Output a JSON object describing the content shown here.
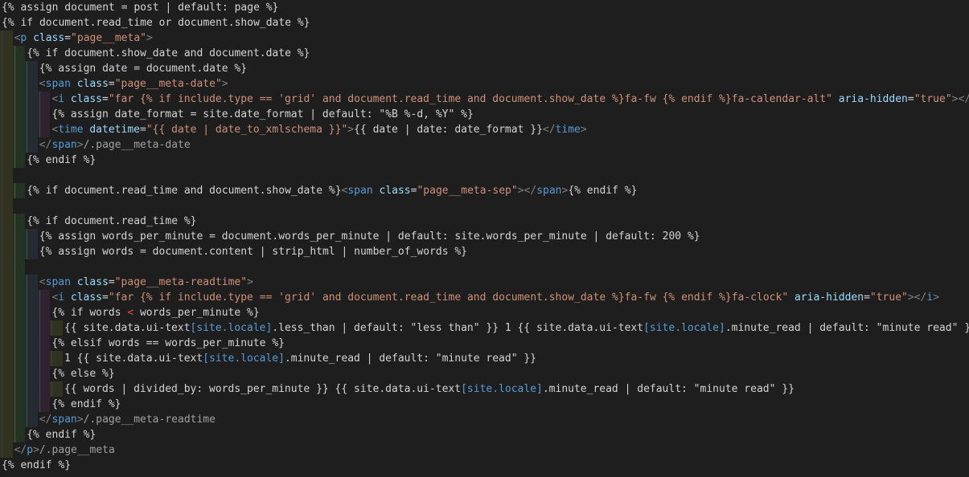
{
  "colors": {
    "background": "#1e1e1e",
    "liquid": "#d4d4d4",
    "tag": "#808080",
    "tag_name": "#569cd6",
    "attr": "#9cdcfe",
    "string": "#ce9178",
    "comment": "#a0a0a0",
    "operator": "#d4d4d4",
    "red": "#f44747"
  },
  "lines": [
    {
      "indent": 0,
      "tokens": [
        [
          "l",
          "{% assign document = post | default: page %}"
        ]
      ]
    },
    {
      "indent": 0,
      "tokens": [
        [
          "l",
          "{% if document.read_time or document.show_date %}"
        ]
      ]
    },
    {
      "indent": 1,
      "tokens": [
        [
          "t",
          "<"
        ],
        [
          "n",
          "p"
        ],
        [
          "t",
          " "
        ],
        [
          "a",
          "class"
        ],
        [
          "l",
          "="
        ],
        [
          "s",
          "\"page__meta\""
        ],
        [
          "t",
          ">"
        ]
      ]
    },
    {
      "indent": 2,
      "tokens": [
        [
          "l",
          "{% if document.show_date and document.date %}"
        ]
      ]
    },
    {
      "indent": 3,
      "tokens": [
        [
          "l",
          "{% assign date = document.date %}"
        ]
      ]
    },
    {
      "indent": 3,
      "tokens": [
        [
          "t",
          "<"
        ],
        [
          "n",
          "span"
        ],
        [
          "t",
          " "
        ],
        [
          "a",
          "class"
        ],
        [
          "l",
          "="
        ],
        [
          "s",
          "\"page__meta-date\""
        ],
        [
          "t",
          ">"
        ]
      ]
    },
    {
      "indent": 4,
      "tokens": [
        [
          "t",
          "<"
        ],
        [
          "n",
          "i"
        ],
        [
          "t",
          " "
        ],
        [
          "a",
          "class"
        ],
        [
          "l",
          "="
        ],
        [
          "s",
          "\"far "
        ],
        [
          "s",
          "{% if include.type == 'grid' and document.read_time and document.show_date %}"
        ],
        [
          "s",
          "fa-fw "
        ],
        [
          "s",
          "{% endif %}"
        ],
        [
          "s",
          "fa-calendar-alt\""
        ],
        [
          "t",
          " "
        ],
        [
          "a",
          "aria-hidden"
        ],
        [
          "l",
          "="
        ],
        [
          "s",
          "\"true\""
        ],
        [
          "t",
          "></"
        ],
        [
          "n",
          "i"
        ],
        [
          "t",
          ">"
        ]
      ]
    },
    {
      "indent": 4,
      "tokens": [
        [
          "l",
          "{% assign date_format = site.date_format | default: \"%B %-d, %Y\" %}"
        ]
      ]
    },
    {
      "indent": 4,
      "tokens": [
        [
          "t",
          "<"
        ],
        [
          "n",
          "time"
        ],
        [
          "t",
          " "
        ],
        [
          "a",
          "datetime"
        ],
        [
          "l",
          "="
        ],
        [
          "s",
          "\"{{ date | date_to_xmlschema }}\""
        ],
        [
          "t",
          ">"
        ],
        [
          "l",
          "{{ date | date: date_format }}"
        ],
        [
          "t",
          "</"
        ],
        [
          "n",
          "time"
        ],
        [
          "t",
          ">"
        ]
      ]
    },
    {
      "indent": 3,
      "tokens": [
        [
          "t",
          "</"
        ],
        [
          "n",
          "span"
        ],
        [
          "t",
          ">"
        ],
        [
          "c",
          "/.page__meta-date"
        ]
      ]
    },
    {
      "indent": 2,
      "tokens": [
        [
          "l",
          "{% endif %}"
        ]
      ]
    },
    {
      "indent": 1,
      "tokens": []
    },
    {
      "indent": 2,
      "tokens": [
        [
          "l",
          "{% if document.read_time and document.show_date %}"
        ],
        [
          "t",
          "<"
        ],
        [
          "n",
          "span"
        ],
        [
          "t",
          " "
        ],
        [
          "a",
          "class"
        ],
        [
          "l",
          "="
        ],
        [
          "s",
          "\"page__meta-sep\""
        ],
        [
          "t",
          "></"
        ],
        [
          "n",
          "span"
        ],
        [
          "t",
          ">"
        ],
        [
          "l",
          "{% endif %}"
        ]
      ]
    },
    {
      "indent": 1,
      "tokens": []
    },
    {
      "indent": 2,
      "tokens": [
        [
          "l",
          "{% if document.read_time %}"
        ]
      ]
    },
    {
      "indent": 3,
      "tokens": [
        [
          "l",
          "{% assign words_per_minute = document.words_per_minute | default: site.words_per_minute | default: 200 %}"
        ]
      ]
    },
    {
      "indent": 3,
      "tokens": [
        [
          "l",
          "{% assign words = document.content | strip_html | number_of_words %}"
        ]
      ]
    },
    {
      "indent": 2,
      "tokens": []
    },
    {
      "indent": 3,
      "tokens": [
        [
          "t",
          "<"
        ],
        [
          "n",
          "span"
        ],
        [
          "t",
          " "
        ],
        [
          "a",
          "class"
        ],
        [
          "l",
          "="
        ],
        [
          "s",
          "\"page__meta-readtime\""
        ],
        [
          "t",
          ">"
        ]
      ]
    },
    {
      "indent": 4,
      "tokens": [
        [
          "t",
          "<"
        ],
        [
          "n",
          "i"
        ],
        [
          "t",
          " "
        ],
        [
          "a",
          "class"
        ],
        [
          "l",
          "="
        ],
        [
          "s",
          "\"far "
        ],
        [
          "s",
          "{% if include.type == 'grid' and document.read_time and document.show_date %}"
        ],
        [
          "s",
          "fa-fw "
        ],
        [
          "s",
          "{% endif %}"
        ],
        [
          "s",
          "fa-clock\""
        ],
        [
          "t",
          " "
        ],
        [
          "a",
          "aria-hidden"
        ],
        [
          "l",
          "="
        ],
        [
          "s",
          "\"true\""
        ],
        [
          "t",
          "></"
        ],
        [
          "n",
          "i"
        ],
        [
          "t",
          ">"
        ]
      ]
    },
    {
      "indent": 4,
      "tokens": [
        [
          "l",
          "{% if words "
        ],
        [
          "r",
          "<"
        ],
        [
          "l",
          " words_per_minute %}"
        ]
      ]
    },
    {
      "indent": 5,
      "tokens": [
        [
          "l",
          "{{ site.data.ui-text"
        ],
        [
          "n",
          "[site.locale]"
        ],
        [
          "l",
          ".less_than | default: \"less than\" }} 1 {{ site.data.ui-text"
        ],
        [
          "n",
          "[site.locale]"
        ],
        [
          "l",
          ".minute_read | default: \"minute read\" }}"
        ]
      ]
    },
    {
      "indent": 4,
      "tokens": [
        [
          "l",
          "{% elsif words == words_per_minute %}"
        ]
      ]
    },
    {
      "indent": 5,
      "tokens": [
        [
          "l",
          "1 {{ site.data.ui-text"
        ],
        [
          "n",
          "[site.locale]"
        ],
        [
          "l",
          ".minute_read | default: \"minute read\" }}"
        ]
      ]
    },
    {
      "indent": 4,
      "tokens": [
        [
          "l",
          "{% else %}"
        ]
      ]
    },
    {
      "indent": 5,
      "tokens": [
        [
          "l",
          "{{ words | divided_by: words_per_minute }} {{ site.data.ui-text"
        ],
        [
          "n",
          "[site.locale]"
        ],
        [
          "l",
          ".minute_read | default: \"minute read\" }}"
        ]
      ]
    },
    {
      "indent": 4,
      "tokens": [
        [
          "l",
          "{% endif %}"
        ]
      ]
    },
    {
      "indent": 3,
      "tokens": [
        [
          "t",
          "</"
        ],
        [
          "n",
          "span"
        ],
        [
          "t",
          ">"
        ],
        [
          "c",
          "/.page__meta-readtime"
        ]
      ]
    },
    {
      "indent": 2,
      "tokens": [
        [
          "l",
          "{% endif %}"
        ]
      ]
    },
    {
      "indent": 1,
      "tokens": [
        [
          "t",
          "</"
        ],
        [
          "n",
          "p"
        ],
        [
          "t",
          ">"
        ],
        [
          "c",
          "/.page__meta"
        ]
      ]
    },
    {
      "indent": 0,
      "tokens": [
        [
          "l",
          "{% endif %}"
        ]
      ]
    }
  ]
}
